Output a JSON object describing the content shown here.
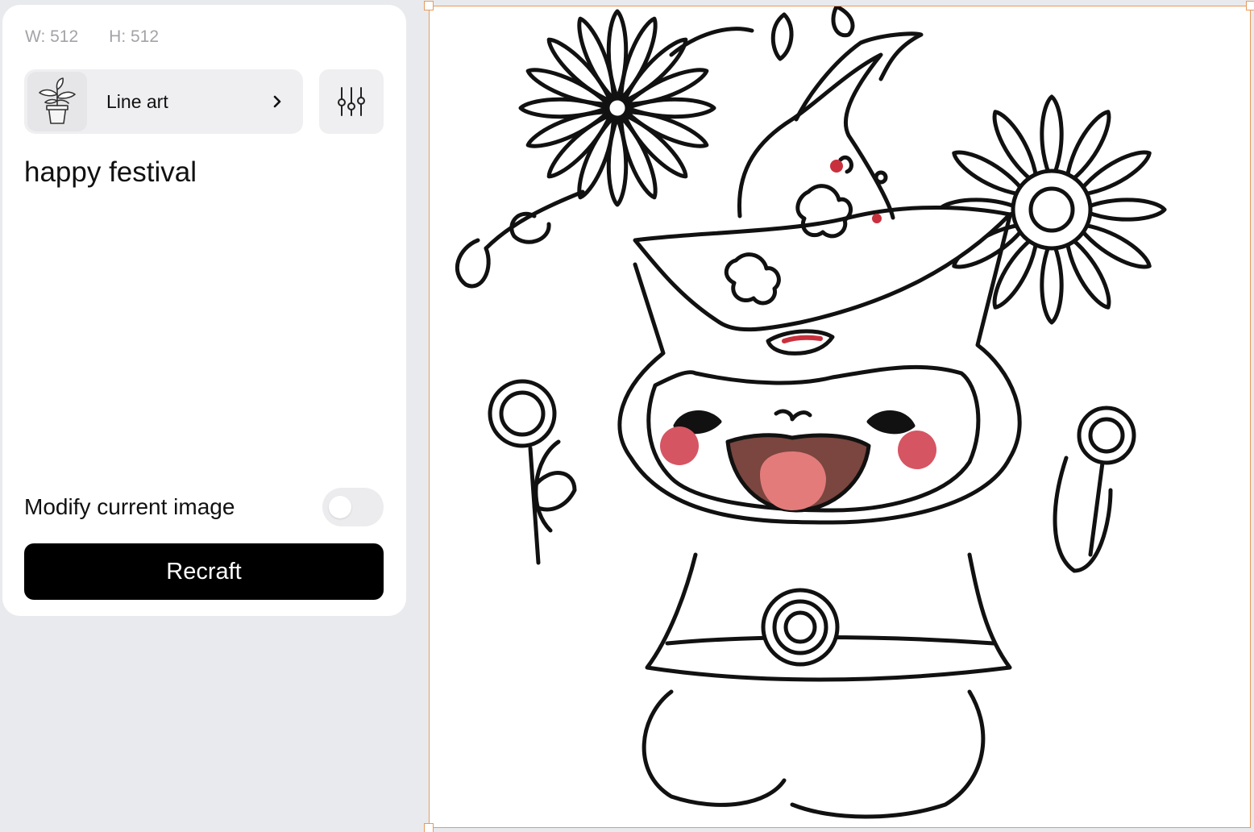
{
  "size": {
    "width_label": "W: 512",
    "height_label": "H: 512"
  },
  "style": {
    "label": "Line art",
    "thumb_icon": "potted-plant-icon",
    "chevron_icon": "chevron-right-icon"
  },
  "settings": {
    "icon": "sliders-icon"
  },
  "prompt": {
    "value": "happy festival"
  },
  "modify": {
    "label": "Modify current image",
    "enabled": false
  },
  "action": {
    "label": "Recraft"
  },
  "canvas": {
    "content": "line-art cat with festival hat, flowers and lollipops",
    "selection_color": "#e79a5b"
  },
  "colors": {
    "panel_bg": "#ffffff",
    "app_bg": "#e9eaed",
    "button_bg": "#000000",
    "chip_bg": "#efeff1"
  }
}
